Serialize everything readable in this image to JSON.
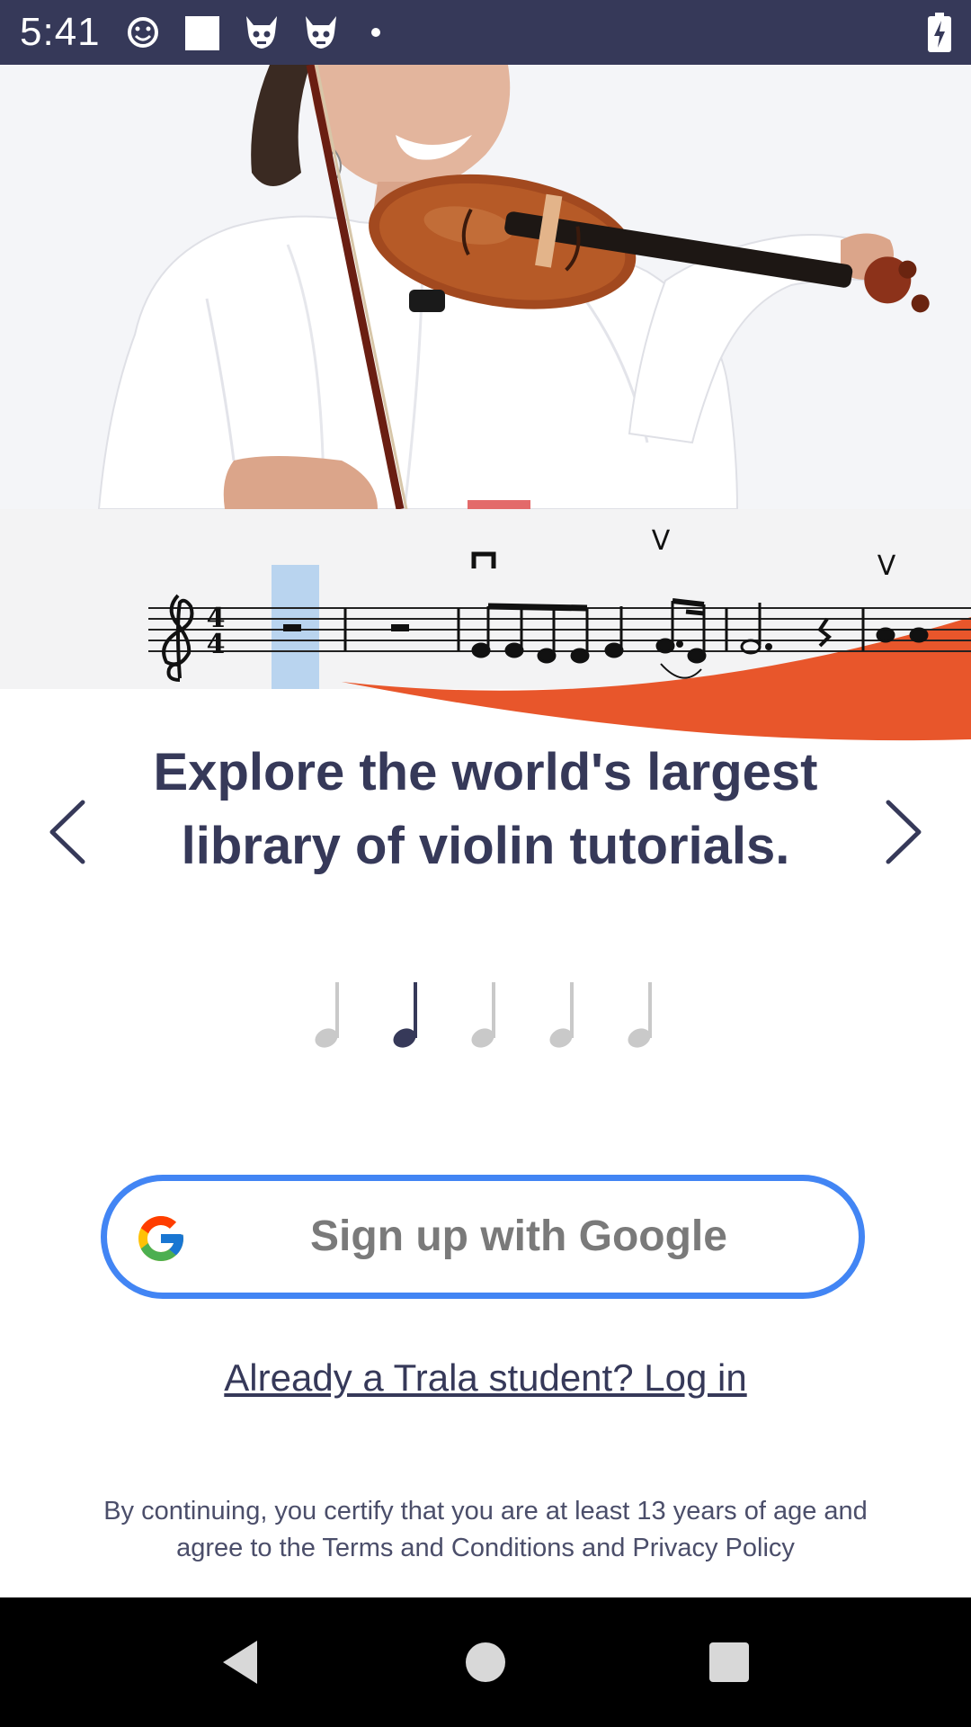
{
  "status_bar": {
    "time": "5:41",
    "icons": [
      "emoji-icon",
      "square-icon",
      "game-icon",
      "game-icon",
      "dot-icon",
      "battery-charging-icon"
    ]
  },
  "hero": {
    "image": "violinist-photo"
  },
  "score": {
    "time_signature_top": "4",
    "time_signature_bottom": "4",
    "bowing_marks": [
      "down-bow",
      "V",
      "V"
    ]
  },
  "carousel": {
    "headline": "Explore the world's largest library of violin tutorials.",
    "prev_icon": "chevron-left-icon",
    "next_icon": "chevron-right-icon",
    "page_count": 5,
    "active_index": 1,
    "indicator_icon": "quarter-note-icon"
  },
  "auth": {
    "google_label": "Sign up with Google",
    "login_text": "Already a Trala student? Log in"
  },
  "legal": {
    "text": "By continuing, you certify that you are at least 13 years of age and agree to the Terms and Conditions and Privacy Policy"
  },
  "nav_bar": {
    "buttons": [
      "back-icon",
      "home-icon",
      "recents-icon"
    ]
  },
  "colors": {
    "brand_navy": "#363959",
    "accent_orange": "#e8562b",
    "google_blue": "#4285f4",
    "indicator_inactive": "#c9c9c9"
  }
}
